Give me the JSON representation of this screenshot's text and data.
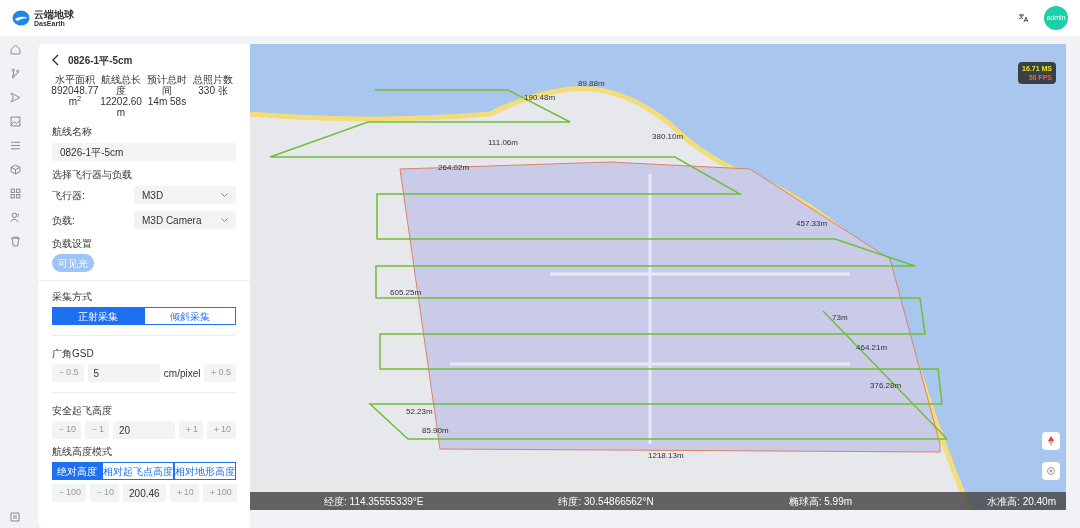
{
  "header": {
    "logo_cn": "云端地球",
    "logo_en": "DasEarth",
    "avatar": "admin"
  },
  "panel": {
    "title": "0826-1平-5cm",
    "stats": [
      {
        "label": "水平面积",
        "value": "892048.77",
        "unit": "m$^{2}$"
      },
      {
        "label": "航线总长度",
        "value": "12202.60",
        "unit": "m"
      },
      {
        "label": "预计总时间",
        "value": "14m 58s"
      },
      {
        "label": "总照片数",
        "value": "330 张"
      }
    ],
    "name_label": "航线名称",
    "name_value": "0826-1平-5cm",
    "device_label": "选择飞行器与负载",
    "selects": [
      {
        "label": "飞行器:",
        "value": "M3D"
      },
      {
        "label": "负载:",
        "value": "M3D Camera"
      }
    ],
    "payload_label": "负载设置",
    "payload_button": "可见光",
    "capture_label": "采集方式",
    "capture_modes": [
      {
        "label": "正射采集",
        "selected": true
      },
      {
        "label": "倾斜采集",
        "selected": false
      }
    ],
    "gsd_label": "广角GSD",
    "gsd": {
      "minus": [
        "－0.5"
      ],
      "value": "5",
      "unit": "cm/pixel",
      "plus": [
        "＋0.5"
      ]
    },
    "takeoff_label": "安全起飞高度",
    "takeoff": {
      "minus": [
        "－10",
        "－1"
      ],
      "value": "20",
      "plus": [
        "＋1",
        "＋10"
      ]
    },
    "alt_mode_label": "航线高度模式",
    "alt_modes": [
      {
        "label": "绝对高度",
        "selected": true
      },
      {
        "label": "相对起飞点高度",
        "selected": false
      },
      {
        "label": "相对地形高度",
        "selected": false
      }
    ],
    "altitude": {
      "minus": [
        "－100",
        "－10"
      ],
      "value": "200.46",
      "plus": [
        "＋10",
        "＋100"
      ]
    }
  },
  "map": {
    "perf": {
      "ms": "16.71 MS",
      "fps": "58 FPS"
    },
    "distances": [
      "190.48m",
      "89.88m",
      "380.10m",
      "111.06m",
      "264.02m",
      "457.33m",
      "605.25m",
      "73m",
      "464.21m",
      "376.28m",
      "52.23m",
      "85.90m",
      "1218.13m"
    ],
    "status": {
      "lon": "经度: 114.35555339°E",
      "lat": "纬度: 30.54866562°N",
      "ellipsoid": "椭球高: 5.99m",
      "sea": "水准高: 20.40m"
    }
  }
}
